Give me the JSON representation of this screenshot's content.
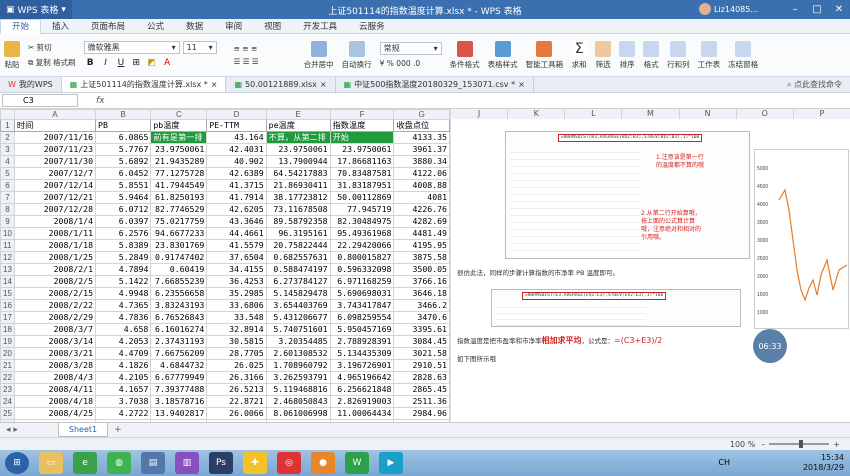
{
  "window": {
    "app_name": "WPS 表格",
    "title": "上证501114的指数温度计算.xlsx * - WPS 表格",
    "user": "Liz14085...",
    "ctl_min": "–",
    "ctl_max": "□",
    "ctl_close": "✕"
  },
  "menu": [
    "开始",
    "插入",
    "页面布局",
    "公式",
    "数据",
    "审阅",
    "视图",
    "开发工具",
    "云服务"
  ],
  "ribbon": {
    "paste": "粘贴",
    "cut": "剪切",
    "copy": "复制",
    "format_painter": "格式刷",
    "font_name": "微软雅黑",
    "font_size": "11",
    "bold": "B",
    "italic": "I",
    "underline": "U",
    "merge": "合并居中",
    "wrap": "自动换行",
    "number_format": "常规",
    "cond_format": "条件格式",
    "table_style": "表格样式",
    "smart_toolbox": "智能工具箱",
    "sum": "求和",
    "filter": "筛选",
    "sort": "排序",
    "format": "格式",
    "row_col": "行和列",
    "worksheet": "工作表",
    "freeze": "冻结窗格"
  },
  "doc_tabs": [
    "我的WPS",
    "上证501114的指数温度计算.xlsx *",
    "50.00121889.xlsx",
    "中证500指数温度20180329_153071.csv *"
  ],
  "search_hint": "点此查找命令",
  "formula_bar": {
    "cell": "C3",
    "fx": "fx",
    "value": ""
  },
  "columns": [
    "A",
    "B",
    "C",
    "D",
    "E",
    "F",
    "G"
  ],
  "header_row": {
    "A": "时间",
    "B": "PB",
    "C": "pb温度",
    "D": "PE-TTM",
    "E": "pe温度",
    "F": "指数温度",
    "G": "收盘点位"
  },
  "row2": {
    "A": "2007/11/16",
    "B": "6.0865",
    "C": "前有是第一排",
    "D": "43.164",
    "E": "不算，从第二排",
    "F": "开始",
    "G": "4133.35"
  },
  "rows": [
    [
      "2007/11/23",
      "5.7767",
      "23.9750061",
      "42.4031",
      "23.9750061",
      "23.9750061",
      "3961.37"
    ],
    [
      "2007/11/30",
      "5.6892",
      "21.9435289",
      "40.902",
      "13.7900944",
      "17.86681163",
      "3880.34"
    ],
    [
      "2007/12/7",
      "6.0452",
      "77.1275728",
      "42.6389",
      "64.54217883",
      "70.83487581",
      "4122.06"
    ],
    [
      "2007/12/14",
      "5.8551",
      "41.7944549",
      "41.3715",
      "21.86930411",
      "31.83187951",
      "4008.88"
    ],
    [
      "2007/12/21",
      "5.9464",
      "61.8250193",
      "41.7914",
      "38.17723812",
      "50.00112869",
      "4081"
    ],
    [
      "2007/12/28",
      "6.0712",
      "82.7746529",
      "42.6205",
      "73.11678508",
      "77.945719",
      "4226.76"
    ],
    [
      "2008/1/4",
      "6.0397",
      "75.0217759",
      "43.3646",
      "89.58792358",
      "82.30484975",
      "4282.69"
    ],
    [
      "2008/1/11",
      "6.2576",
      "94.6677233",
      "44.4661",
      "96.3195161",
      "95.49361968",
      "4481.49"
    ],
    [
      "2008/1/18",
      "5.8389",
      "23.8301769",
      "41.5579",
      "20.75822444",
      "22.29420066",
      "4195.95"
    ],
    [
      "2008/1/25",
      "5.2849",
      "0.91747402",
      "37.6504",
      "0.682557631",
      "0.800015827",
      "3875.58"
    ],
    [
      "2008/2/1",
      "4.7894",
      "0.60419",
      "34.4155",
      "0.588474197",
      "0.596332098",
      "3500.05"
    ],
    [
      "2008/2/5",
      "5.1422",
      "7.66855239",
      "36.4253",
      "6.273784127",
      "6.971168259",
      "3766.16"
    ],
    [
      "2008/2/15",
      "4.9948",
      "6.23556658",
      "35.2985",
      "5.145829478",
      "5.690698031",
      "3646.18"
    ],
    [
      "2008/2/22",
      "4.7365",
      "3.83243193",
      "33.6806",
      "3.654403769",
      "3.743417847",
      "3466.2"
    ],
    [
      "2008/2/29",
      "4.7836",
      "6.76526843",
      "33.548",
      "5.431206677",
      "6.098259554",
      "3470.6"
    ],
    [
      "2008/3/7",
      "4.658",
      "6.16016274",
      "32.8914",
      "5.740751601",
      "5.950457169",
      "3395.61"
    ],
    [
      "2008/3/14",
      "4.2053",
      "2.37431193",
      "30.5815",
      "3.20354485",
      "2.788928391",
      "3084.45"
    ],
    [
      "2008/3/21",
      "4.4709",
      "7.66756209",
      "28.7705",
      "2.601308532",
      "5.134435309",
      "3021.58"
    ],
    [
      "2008/3/28",
      "4.1826",
      "4.6844732",
      "26.025",
      "1.708960792",
      "3.196726901",
      "2910.51"
    ],
    [
      "2008/4/3",
      "4.2105",
      "6.67779949",
      "26.3166",
      "3.262593791",
      "4.965196642",
      "2828.63"
    ],
    [
      "2008/4/11",
      "4.1657",
      "7.39377488",
      "26.5213",
      "5.119468816",
      "6.256621848",
      "2865.45"
    ],
    [
      "2008/4/18",
      "3.7038",
      "3.18578716",
      "22.8721",
      "2.468050843",
      "2.826919003",
      "2511.36"
    ],
    [
      "2008/4/25",
      "4.2722",
      "13.9402817",
      "26.0066",
      "8.061006998",
      "11.00064434",
      "2984.96"
    ],
    [
      "2008/4/30",
      "4.3264",
      "16.490464",
      "26.3913",
      "10.17182096",
      "13.33114248",
      "3125.53"
    ],
    [
      "2008/5/9",
      "4.1241",
      "12.0781488",
      "25.1548",
      "8.600334727",
      "10.33924174",
      "2978.19"
    ]
  ],
  "image_panel": {
    "columns": [
      "J",
      "K",
      "L",
      "M",
      "N",
      "O",
      "P"
    ],
    "formula_text_1": "=NORMSDIST(B3,AVERAGE(B$2:B3),STDEV(B$2:B3),1)*100",
    "annotation_1": "1.注意该是第一行的温度都不算的哦",
    "annotation_2": "2.从第二行开始算哦，按上面的公式算计算哦，注意绝对和相对的引用哦。",
    "caption_1": "很仿此法，同样的步骤计算指数的市净率 PB 温度即可。",
    "formula_text_2": "=NORMSDIST(E3,AVERAGE(E$2:E3),STDEV(E$2:E3),1)*100",
    "caption_2_prefix": "指数温度是把市盈率和市净率",
    "caption_2_emph": "相加求平均",
    "caption_2_suffix": "，公式是：",
    "caption_2_formula": "=(C3+E3)/2",
    "caption_3": "如下图所示哦",
    "timer": "06:33",
    "chart_ticks": [
      "5000",
      "4500",
      "4000",
      "3500",
      "3000",
      "2500",
      "2000",
      "1500",
      "1000"
    ]
  },
  "sheet_tab": "Sheet1",
  "status": {
    "zoom": "100 %",
    "minus": "–",
    "plus": "+"
  },
  "taskbar": {
    "time": "15:34",
    "date": "2018/3/29",
    "lang": "CH"
  },
  "colors": {
    "title_bg": "#3a6fb0",
    "highlight_green": "#1f9a3c",
    "accent_red": "#d82020"
  }
}
